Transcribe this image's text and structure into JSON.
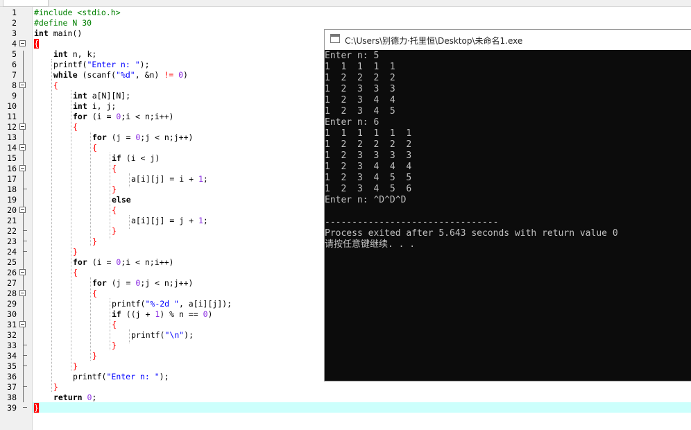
{
  "editor": {
    "line_numbers": [
      "1",
      "2",
      "3",
      "4",
      "5",
      "6",
      "7",
      "8",
      "9",
      "10",
      "11",
      "12",
      "13",
      "14",
      "15",
      "16",
      "17",
      "18",
      "19",
      "20",
      "21",
      "22",
      "23",
      "24",
      "25",
      "26",
      "27",
      "28",
      "29",
      "30",
      "31",
      "32",
      "33",
      "34",
      "35",
      "36",
      "37",
      "38",
      "39"
    ],
    "code": {
      "l1": {
        "a": "#include <stdio.h>"
      },
      "l2": {
        "a": "#define N 30"
      },
      "l3": {
        "kw": "int",
        "a": " main()"
      },
      "l4": {
        "brace": "{"
      },
      "l5": {
        "kw": "int",
        "a": " n, k;"
      },
      "l6": {
        "a": "printf(",
        "s": "\"Enter n: \"",
        "b": ");"
      },
      "l7": {
        "kw": "while",
        "a": " (scanf(",
        "s": "\"%d\"",
        "b": ", &n) ",
        "op": "!=",
        "sp": " ",
        "n": "0",
        "c": ")"
      },
      "l8": {
        "brace": "{"
      },
      "l9": {
        "kw": "int",
        "a": " a[N][N];"
      },
      "l10": {
        "kw": "int",
        "a": " i, j;"
      },
      "l11": {
        "kw": "for",
        "a": " (i = ",
        "n": "0",
        "b": ";i < n;i++)"
      },
      "l12": {
        "brace": "{"
      },
      "l13": {
        "kw": "for",
        "a": " (j = ",
        "n": "0",
        "b": ";j < n;j++)"
      },
      "l14": {
        "brace": "{"
      },
      "l15": {
        "kw": "if",
        "a": " (i < j)"
      },
      "l16": {
        "brace": "{"
      },
      "l17": {
        "a": "a[i][j] = i + ",
        "n": "1",
        "b": ";"
      },
      "l18": {
        "brace": "}"
      },
      "l19": {
        "kw": "else"
      },
      "l20": {
        "brace": "{"
      },
      "l21": {
        "a": "a[i][j] = j + ",
        "n": "1",
        "b": ";"
      },
      "l22": {
        "brace": "}"
      },
      "l23": {
        "brace": "}"
      },
      "l24": {
        "brace": "}"
      },
      "l25": {
        "kw": "for",
        "a": " (i = ",
        "n": "0",
        "b": ";i < n;i++)"
      },
      "l26": {
        "brace": "{"
      },
      "l27": {
        "kw": "for",
        "a": " (j = ",
        "n": "0",
        "b": ";j < n;j++)"
      },
      "l28": {
        "brace": "{"
      },
      "l29": {
        "a": "printf(",
        "s": "\"%-2d \"",
        "b": ", a[i][j]);"
      },
      "l30": {
        "kw": "if",
        "a": " ((j + ",
        "n": "1",
        "b": ") % n == ",
        "n2": "0",
        "c": ")"
      },
      "l31": {
        "brace": "{"
      },
      "l32": {
        "a": "printf(",
        "s": "\"\\n\"",
        "b": ");"
      },
      "l33": {
        "brace": "}"
      },
      "l34": {
        "brace": "}"
      },
      "l35": {
        "brace": "}"
      },
      "l36": {
        "a": "printf(",
        "s": "\"Enter n: \"",
        "b": ");"
      },
      "l37": {
        "brace": "}"
      },
      "l38": {
        "kw": "return",
        "a": " ",
        "n": "0",
        "b": ";"
      },
      "l39": {
        "brace": "}"
      }
    }
  },
  "console": {
    "title": "C:\\Users\\别德力·托里恒\\Desktop\\未命名1.exe",
    "lines": [
      "Enter n: 5",
      "1  1  1  1  1",
      "1  2  2  2  2",
      "1  2  3  3  3",
      "1  2  3  4  4",
      "1  2  3  4  5",
      "Enter n: 6",
      "1  1  1  1  1  1",
      "1  2  2  2  2  2",
      "1  2  3  3  3  3",
      "1  2  3  4  4  4",
      "1  2  3  4  5  5",
      "1  2  3  4  5  6",
      "Enter n: ^D^D^D",
      "",
      "--------------------------------",
      "Process exited after 5.643 seconds with return value 0",
      "请按任意键继续. . ."
    ]
  },
  "colors": {
    "keyword": "#000000",
    "preprocessor": "#008000",
    "string": "#0000ff",
    "number": "#8a2be2",
    "symbol": "#ff0000",
    "current_line": "#ccfffc",
    "console_bg": "#0c0c0c",
    "console_text": "#c0c0c0"
  }
}
